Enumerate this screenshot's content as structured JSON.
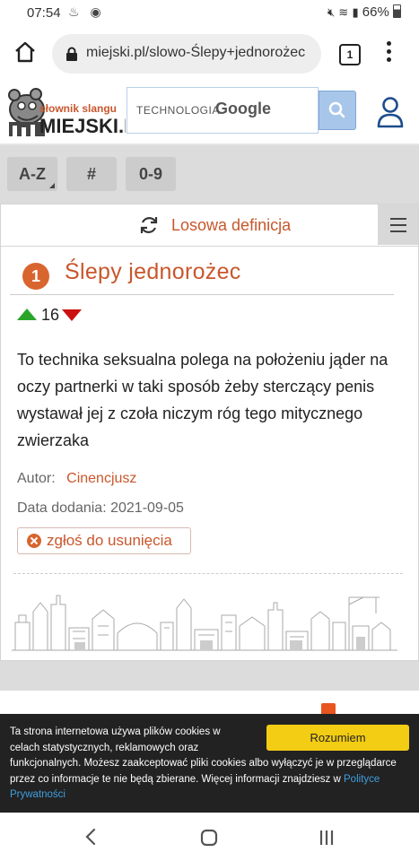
{
  "status_bar": {
    "time": "07:54",
    "battery": "66%"
  },
  "browser": {
    "url": "miejski.pl/slowo-Ślepy+jednorożec",
    "tab_count": "1"
  },
  "header": {
    "logo_top": "słownik slangu",
    "logo_main": "MIEJSKI.PL",
    "search_placeholder": "TECHNOLOGIA",
    "search_brand": "Google"
  },
  "letters": [
    {
      "label": "A-Z"
    },
    {
      "label": "#"
    },
    {
      "label": "0-9"
    }
  ],
  "random_definition": {
    "label": "Losowa definicja"
  },
  "definition": {
    "number": "1",
    "title": "Ślepy jednorożec",
    "votes": "16",
    "text_lines": [
      "To technika seksualna polega na położeniu jąder na",
      "oczy partnerki w taki sposób żeby sterczący penis",
      "wystawał jej z czoła niczym róg tego mitycznego",
      "zwierzaka"
    ],
    "author_label": "Autor:",
    "author": "Cinencjusz",
    "date_label": "Data dodania:",
    "date": "2021-09-05",
    "report_label": "zgłoś do usunięcia"
  },
  "cookie": {
    "lines": [
      "Ta strona internetowa używa plików cookies w",
      "celach statystycznych, reklamowych oraz",
      "funkcjonalnych. Możesz zaakceptować pliki cookies albo wyłączyć je w przeglądarce",
      "przez co informacje te nie będą zbierane. Więcej informacji znajdziesz w"
    ],
    "link_part1": "Polityce",
    "link_part2": "Prywatności",
    "accept_label": "Rozumiem"
  },
  "colors": {
    "accent": "#c8572c",
    "vote_up": "#2aa52a",
    "vote_down": "#cc1010",
    "cookie_button": "#f3cc14"
  },
  "icons": [
    "home-icon",
    "lock-icon",
    "tabs-icon",
    "more-vert-icon",
    "search-icon",
    "user-icon",
    "refresh-icon",
    "list-icon",
    "report-icon",
    "nav-back-icon",
    "nav-home-icon",
    "nav-recents-icon"
  ]
}
